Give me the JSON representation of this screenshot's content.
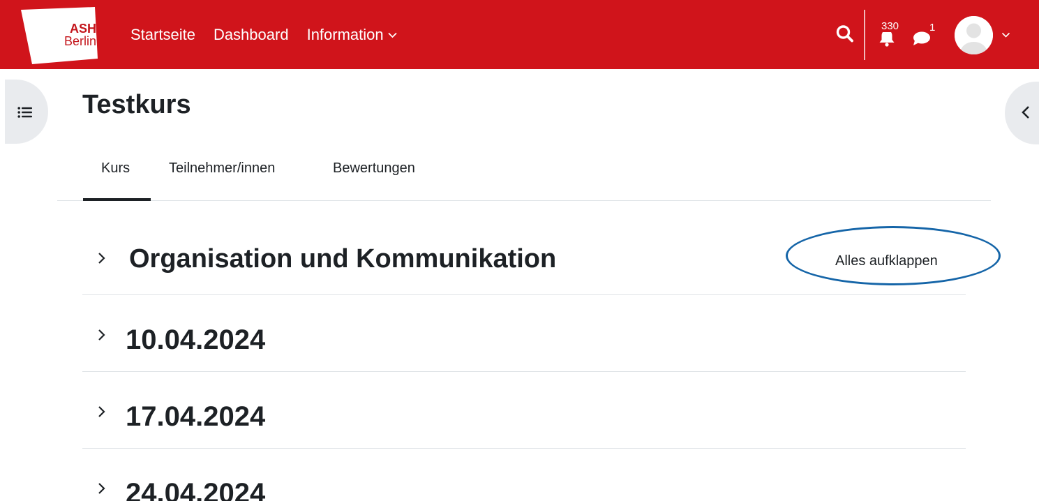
{
  "brand": {
    "line1": "ASH",
    "line2": "Berlin",
    "primary_color": "#d0141b"
  },
  "navbar": {
    "links": [
      "Startseite",
      "Dashboard",
      "Information"
    ],
    "icons": [
      "search-icon",
      "bell-icon",
      "comment-icon",
      "user-avatar-icon",
      "chevron-down-icon"
    ],
    "notifications_count": "330",
    "messages_count": "1"
  },
  "page": {
    "title": "Testkurs"
  },
  "tabs": [
    {
      "label": "Kurs",
      "active": true
    },
    {
      "label": "Teilnehmer/innen",
      "active": false
    },
    {
      "label": "Bewertungen",
      "active": false
    }
  ],
  "course": {
    "expand_all_label": "Alles aufklappen",
    "annotation_color": "#1565a8",
    "sections": [
      {
        "title": "Organisation und Kommunikation",
        "collapsed": true
      },
      {
        "title": "10.04.2024",
        "collapsed": true
      },
      {
        "title": "17.04.2024",
        "collapsed": true
      },
      {
        "title": "24.04.2024",
        "collapsed": true
      }
    ]
  }
}
